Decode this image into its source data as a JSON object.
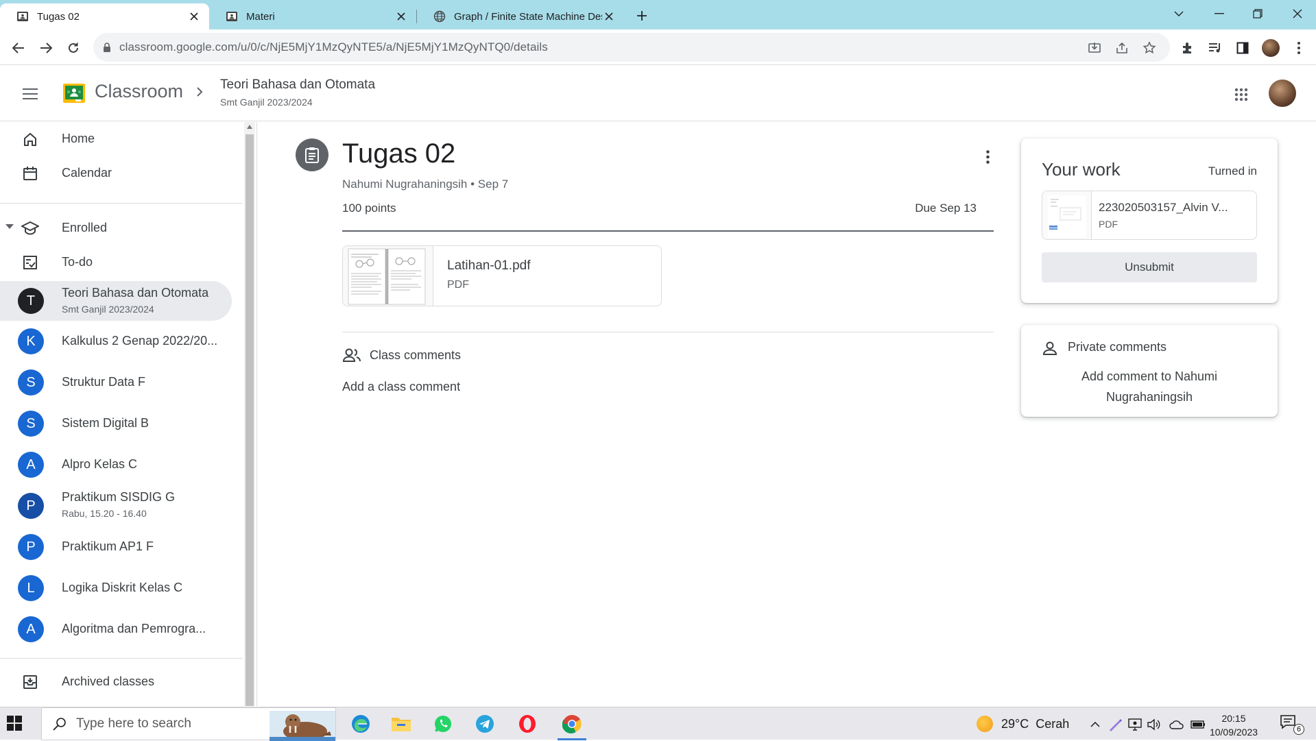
{
  "browser": {
    "tabs": [
      {
        "title": "Tugas 02",
        "favicon": "classroom-icon",
        "active": true
      },
      {
        "title": "Materi",
        "favicon": "classroom-icon",
        "active": false
      },
      {
        "title": "Graph / Finite State Machine Des",
        "favicon": "globe-icon",
        "active": false
      }
    ],
    "url": "classroom.google.com/u/0/c/NjE5MjY1MzQyNTE5/a/NjE5MjY1MzQyNTQ0/details"
  },
  "header": {
    "brand": "Classroom",
    "course_title": "Teori Bahasa dan Otomata",
    "course_subtitle": "Smt Ganjil 2023/2024"
  },
  "sidebar": {
    "home": "Home",
    "calendar": "Calendar",
    "enrolled": "Enrolled",
    "todo": "To-do",
    "courses": [
      {
        "initial": "T",
        "name": "Teori Bahasa dan Otomata",
        "sub": "Smt Ganjil 2023/2024",
        "color": "#202124",
        "selected": true
      },
      {
        "initial": "K",
        "name": "Kalkulus 2 Genap 2022/20...",
        "sub": "",
        "color": "#1967d2"
      },
      {
        "initial": "S",
        "name": "Struktur Data F",
        "sub": "",
        "color": "#1967d2"
      },
      {
        "initial": "S",
        "name": "Sistem Digital B",
        "sub": "",
        "color": "#1967d2"
      },
      {
        "initial": "A",
        "name": "Alpro Kelas C",
        "sub": "",
        "color": "#1967d2"
      },
      {
        "initial": "P",
        "name": "Praktikum SISDIG G",
        "sub": "Rabu, 15.20 - 16.40",
        "color": "#174ea6"
      },
      {
        "initial": "P",
        "name": "Praktikum AP1 F",
        "sub": "",
        "color": "#1967d2"
      },
      {
        "initial": "L",
        "name": "Logika Diskrit Kelas C",
        "sub": "",
        "color": "#1967d2"
      },
      {
        "initial": "A",
        "name": "Algoritma dan Pemrogra...",
        "sub": "",
        "color": "#1967d2"
      }
    ],
    "archived": "Archived classes"
  },
  "assignment": {
    "title": "Tugas 02",
    "meta": "Nahumi Nugrahaningsih • Sep 7",
    "points": "100 points",
    "due": "Due Sep 13",
    "attachment": {
      "name": "Latihan-01.pdf",
      "type": "PDF"
    },
    "class_comments_label": "Class comments",
    "add_class_comment": "Add a class comment"
  },
  "your_work": {
    "title": "Your work",
    "status": "Turned in",
    "file_name": "223020503157_Alvin V...",
    "file_type": "PDF",
    "unsubmit_label": "Unsubmit"
  },
  "private_comments": {
    "label": "Private comments",
    "add": "Add comment to Nahumi Nugrahaningsih"
  },
  "taskbar": {
    "search_placeholder": "Type here to search",
    "apps": [
      "edge-icon",
      "file-explorer-icon",
      "whatsapp-icon",
      "telegram-icon",
      "opera-icon",
      "chrome-icon"
    ],
    "weather": "29°C  Cerah",
    "time": "20:15",
    "date": "10/09/2023",
    "notifications": "6"
  },
  "colors": {
    "tabbar": "#a7dde9",
    "accent_blue": "#1967d2",
    "classroom_green": "#1e8e3e",
    "classroom_yellow": "#fbbc04"
  }
}
